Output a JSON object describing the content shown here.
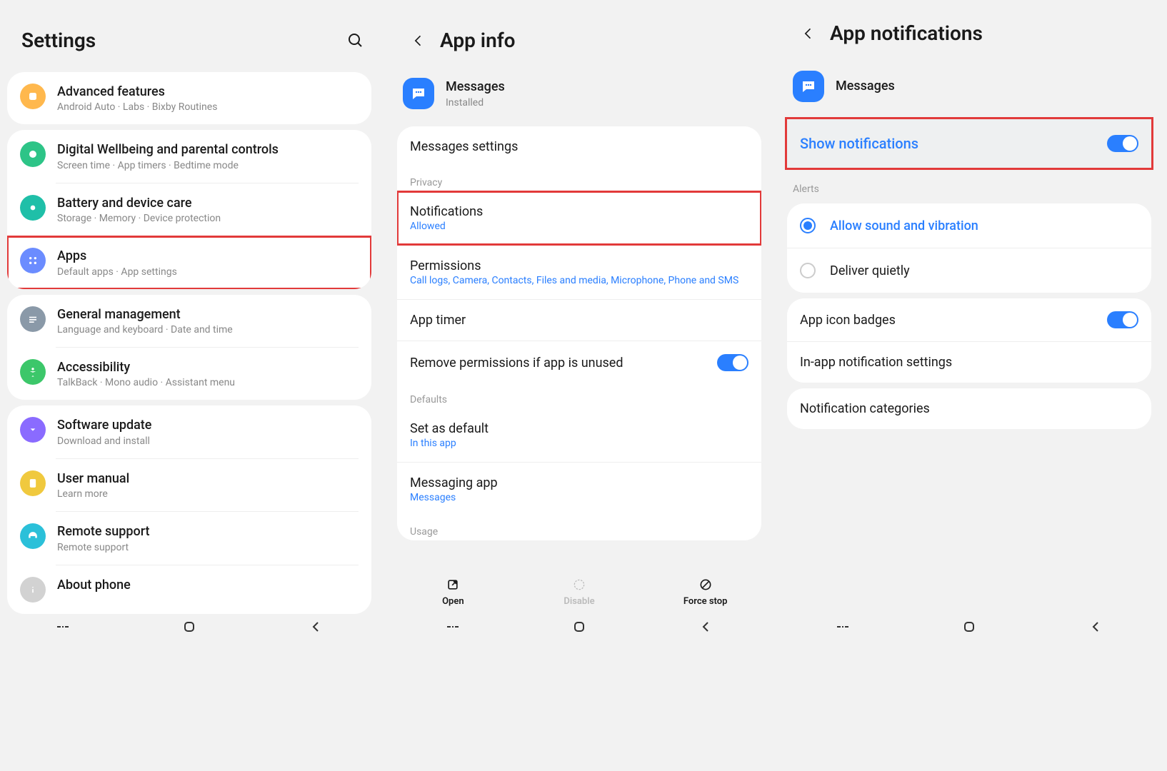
{
  "screen1": {
    "title": "Settings",
    "items": [
      {
        "title": "Advanced features",
        "sub": "Android Auto  ·  Labs  ·  Bixby Routines"
      },
      {
        "title": "Digital Wellbeing and parental controls",
        "sub": "Screen time  ·  App timers  ·  Bedtime mode"
      },
      {
        "title": "Battery and device care",
        "sub": "Storage  ·  Memory  ·  Device protection"
      },
      {
        "title": "Apps",
        "sub": "Default apps  ·  App settings"
      },
      {
        "title": "General management",
        "sub": "Language and keyboard  ·  Date and time"
      },
      {
        "title": "Accessibility",
        "sub": "TalkBack  ·  Mono audio  ·  Assistant menu"
      },
      {
        "title": "Software update",
        "sub": "Download and install"
      },
      {
        "title": "User manual",
        "sub": "Learn more"
      },
      {
        "title": "Remote support",
        "sub": "Remote support"
      },
      {
        "title": "About phone",
        "sub": ""
      }
    ]
  },
  "screen2": {
    "title": "App info",
    "app_name": "Messages",
    "app_status": "Installed",
    "rows": {
      "messages_settings": "Messages settings",
      "privacy_label": "Privacy",
      "notifications": "Notifications",
      "notifications_sub": "Allowed",
      "permissions": "Permissions",
      "permissions_sub": "Call logs, Camera, Contacts, Files and media, Microphone, Phone and SMS",
      "app_timer": "App timer",
      "remove_perms": "Remove permissions if app is unused",
      "defaults_label": "Defaults",
      "set_default": "Set as default",
      "set_default_sub": "In this app",
      "messaging_app": "Messaging app",
      "messaging_app_sub": "Messages",
      "usage_label": "Usage"
    },
    "actions": {
      "open": "Open",
      "disable": "Disable",
      "force_stop": "Force stop"
    }
  },
  "screen3": {
    "title": "App notifications",
    "app_name": "Messages",
    "show_notifications": "Show notifications",
    "alerts_label": "Alerts",
    "allow_sound": "Allow sound and vibration",
    "deliver_quietly": "Deliver quietly",
    "app_icon_badges": "App icon badges",
    "inapp_settings": "In-app notification settings",
    "notif_categories": "Notification categories"
  }
}
